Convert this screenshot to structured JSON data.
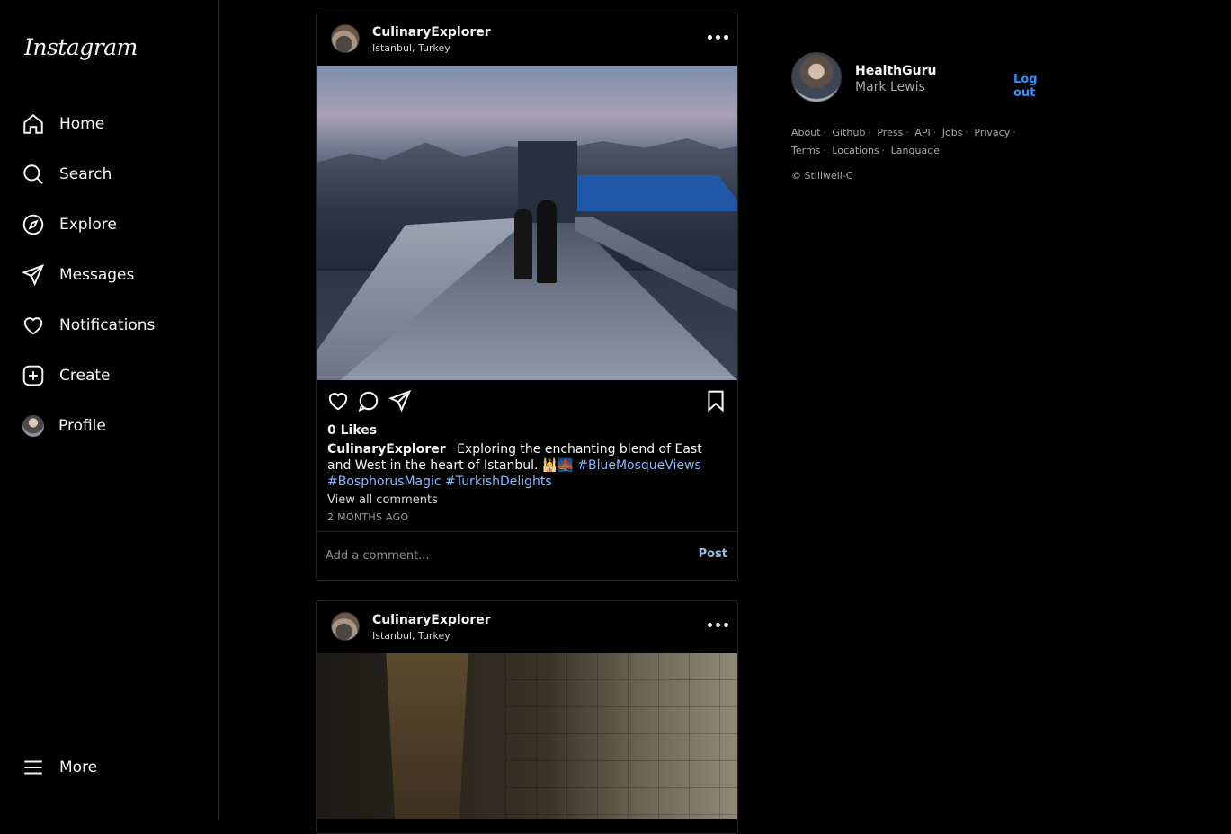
{
  "app": {
    "logo_text": "Instagram"
  },
  "sidebar": {
    "items": [
      {
        "label": "Home",
        "icon": "home-icon"
      },
      {
        "label": "Search",
        "icon": "search-icon"
      },
      {
        "label": "Explore",
        "icon": "compass-icon"
      },
      {
        "label": "Messages",
        "icon": "send-icon"
      },
      {
        "label": "Notifications",
        "icon": "heart-icon"
      },
      {
        "label": "Create",
        "icon": "plus-square-icon"
      },
      {
        "label": "Profile",
        "icon": "avatar"
      }
    ],
    "more_label": "More"
  },
  "posts": [
    {
      "username": "CulinaryExplorer",
      "location": "Istanbul, Turkey",
      "likes": "0 Likes",
      "caption_user": "CulinaryExplorer",
      "caption_text": "Exploring the enchanting blend of East and West in the heart of Istanbul. 🕌🌉",
      "hashtags": [
        "#BlueMosqueViews",
        "#BosphorusMagic",
        "#TurkishDelights"
      ],
      "view_comments": "View all comments",
      "time": "2 MONTHS AGO",
      "comment_placeholder": "Add a comment...",
      "post_button": "Post"
    },
    {
      "username": "CulinaryExplorer",
      "location": "Istanbul, Turkey"
    }
  ],
  "current_user": {
    "username": "HealthGuru",
    "name": "Mark Lewis",
    "logout_label": "Log out"
  },
  "footer": {
    "links_row1": [
      "About",
      "Github",
      "Press",
      "API",
      "Jobs",
      "Privacy"
    ],
    "links_row2": [
      "Terms",
      "Locations",
      "Language"
    ],
    "copyright": "© Stillwell-C"
  },
  "colors": {
    "background": "#000000",
    "text": "#f5f5f5",
    "link_blue": "#2f8fff",
    "hashtag": "#8bb8ff",
    "border": "#262626"
  }
}
